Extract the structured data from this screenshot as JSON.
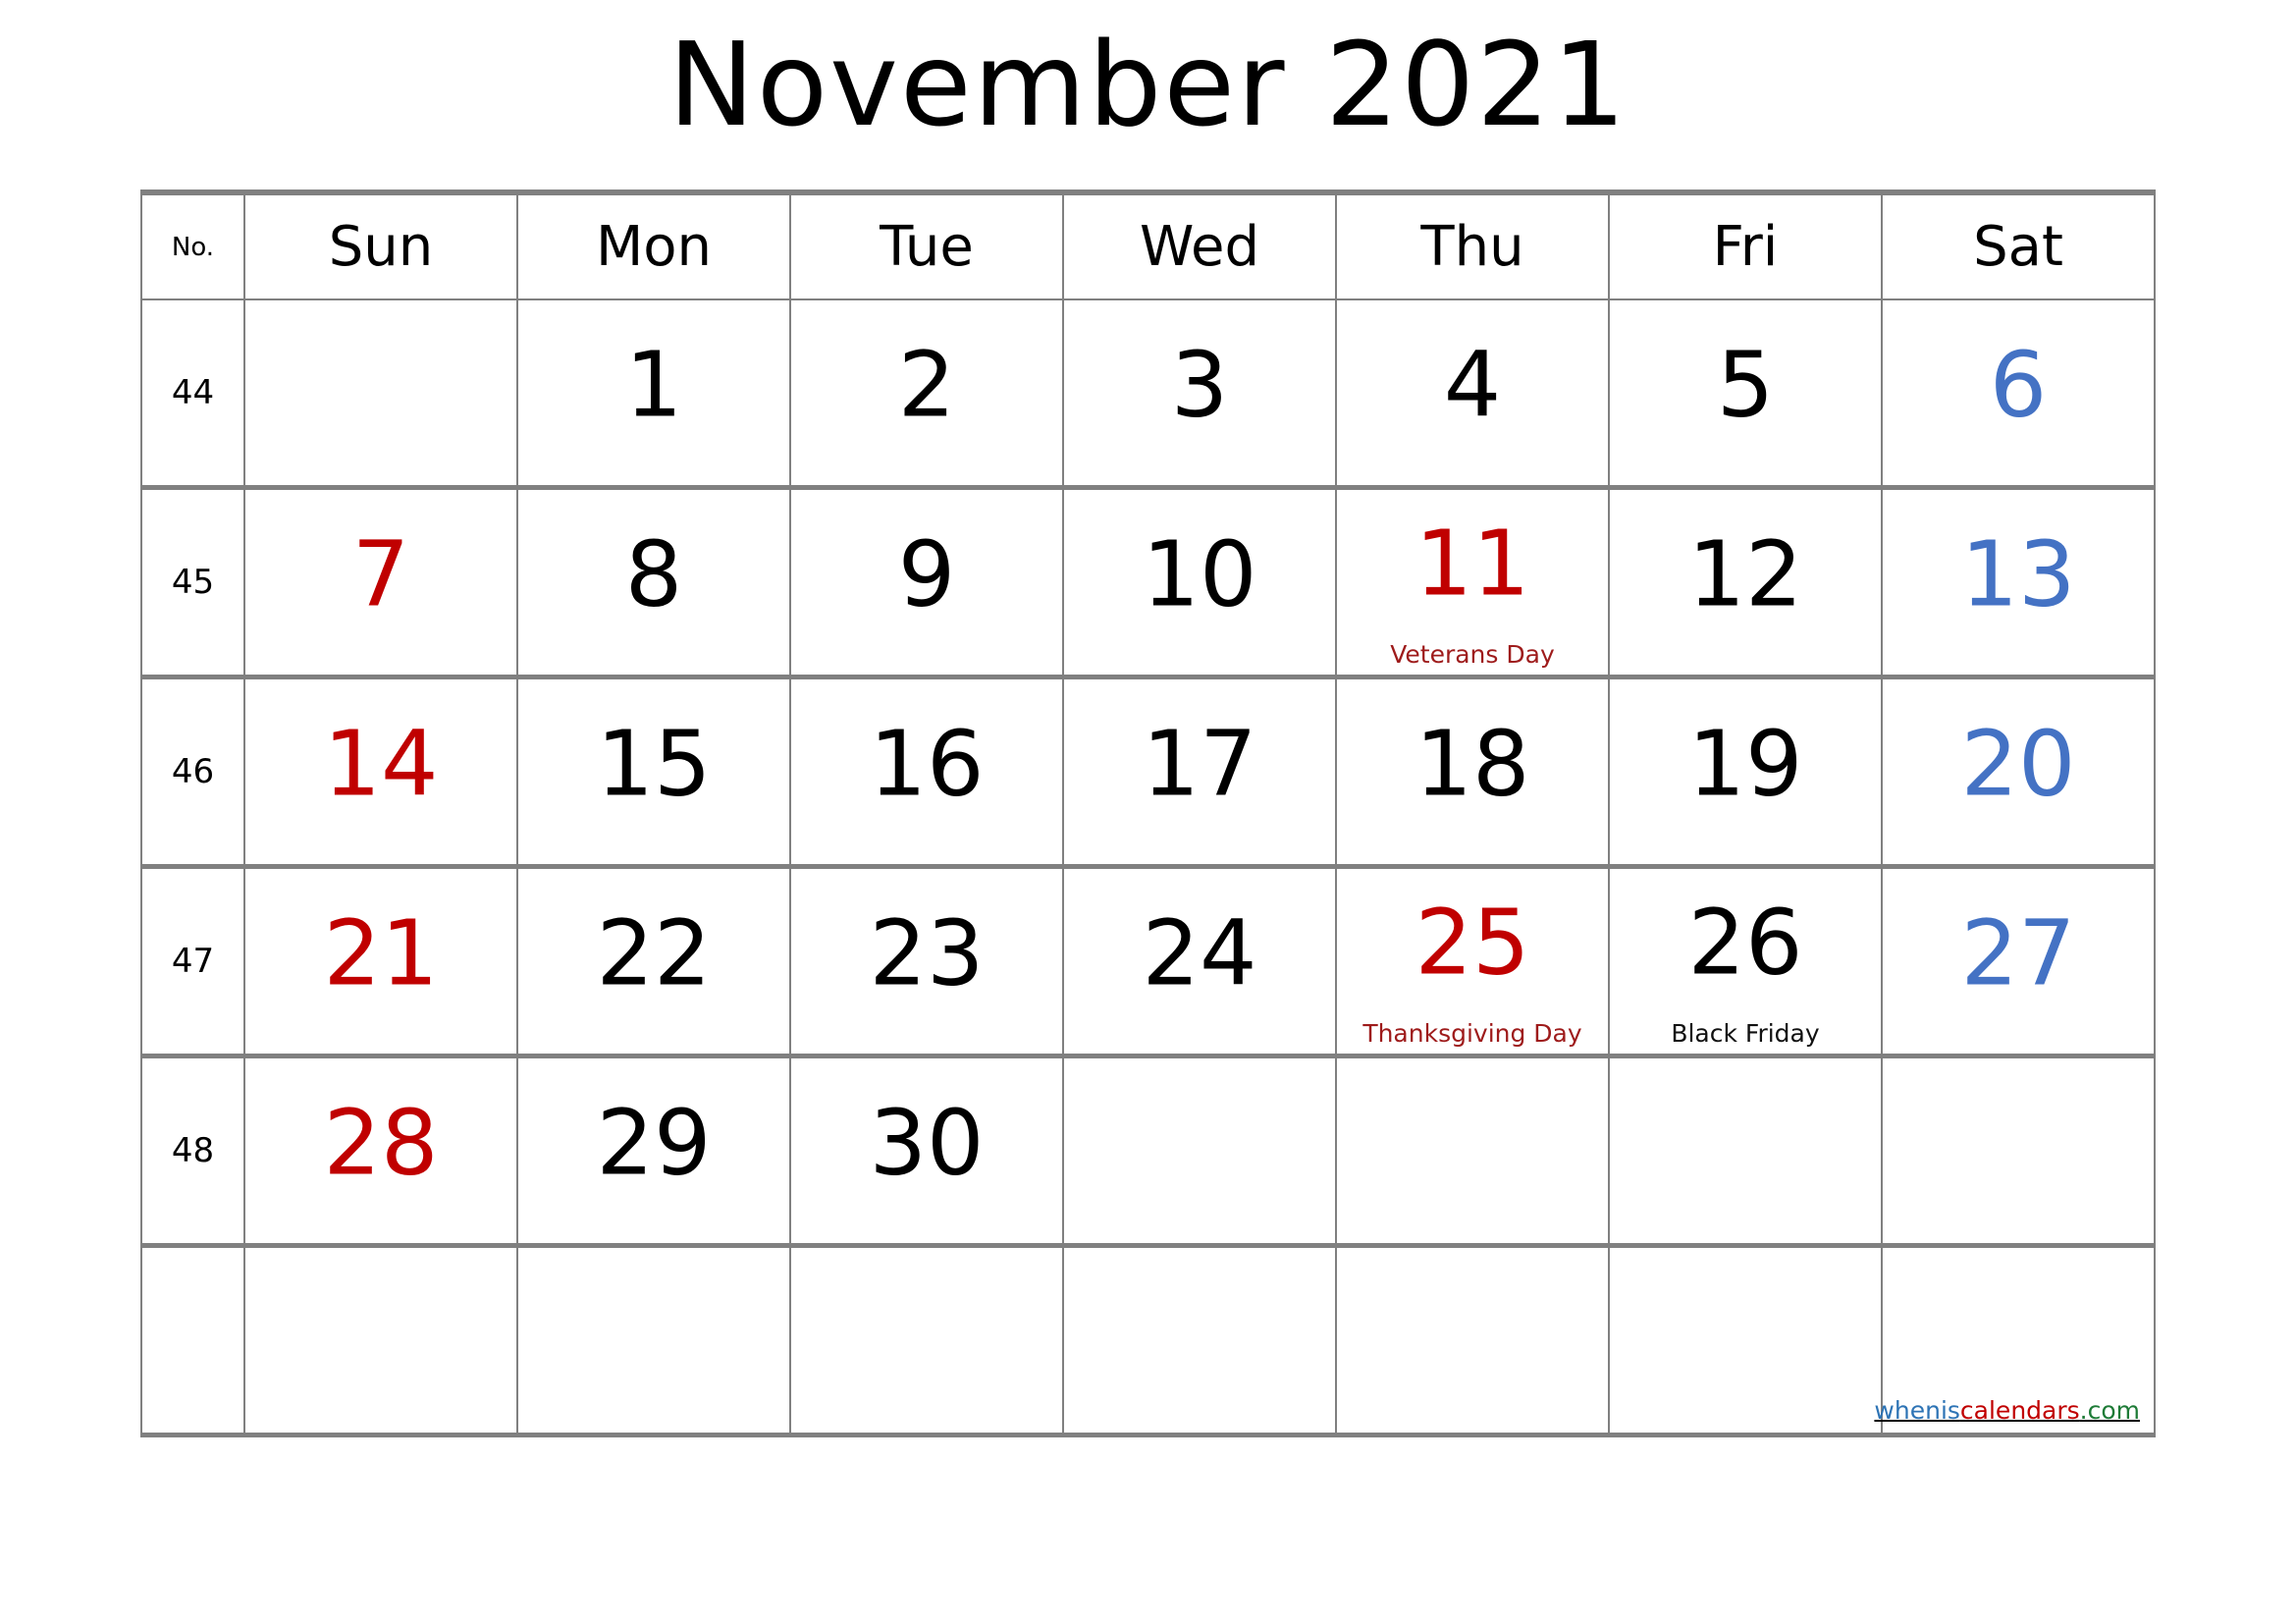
{
  "title": "November 2021",
  "month": "November",
  "year": "2021",
  "header": {
    "week_number_label": "No.",
    "days": [
      "Sun",
      "Mon",
      "Tue",
      "Wed",
      "Thu",
      "Fri",
      "Sat"
    ]
  },
  "colors": {
    "sunday": "#C00000",
    "saturday": "#4472C4",
    "holiday": "#C00000",
    "weekday": "#000000",
    "grid": "#808080",
    "note_red": "#9E1B1B",
    "note_black": "#111111",
    "watermark_blue": "#2E74B5",
    "watermark_red": "#C00000",
    "watermark_green": "#1E7B37"
  },
  "weeks": [
    {
      "number": "44",
      "days": [
        {
          "date": "",
          "style": "sun",
          "note": "",
          "note_style": ""
        },
        {
          "date": "1",
          "style": "wk",
          "note": "",
          "note_style": ""
        },
        {
          "date": "2",
          "style": "wk",
          "note": "",
          "note_style": ""
        },
        {
          "date": "3",
          "style": "wk",
          "note": "",
          "note_style": ""
        },
        {
          "date": "4",
          "style": "wk",
          "note": "",
          "note_style": ""
        },
        {
          "date": "5",
          "style": "wk",
          "note": "",
          "note_style": ""
        },
        {
          "date": "6",
          "style": "sat",
          "note": "",
          "note_style": ""
        }
      ]
    },
    {
      "number": "45",
      "days": [
        {
          "date": "7",
          "style": "sun",
          "note": "",
          "note_style": ""
        },
        {
          "date": "8",
          "style": "wk",
          "note": "",
          "note_style": ""
        },
        {
          "date": "9",
          "style": "wk",
          "note": "",
          "note_style": ""
        },
        {
          "date": "10",
          "style": "wk",
          "note": "",
          "note_style": ""
        },
        {
          "date": "11",
          "style": "hol",
          "note": "Veterans Day",
          "note_style": "red"
        },
        {
          "date": "12",
          "style": "wk",
          "note": "",
          "note_style": ""
        },
        {
          "date": "13",
          "style": "sat",
          "note": "",
          "note_style": ""
        }
      ]
    },
    {
      "number": "46",
      "days": [
        {
          "date": "14",
          "style": "sun",
          "note": "",
          "note_style": ""
        },
        {
          "date": "15",
          "style": "wk",
          "note": "",
          "note_style": ""
        },
        {
          "date": "16",
          "style": "wk",
          "note": "",
          "note_style": ""
        },
        {
          "date": "17",
          "style": "wk",
          "note": "",
          "note_style": ""
        },
        {
          "date": "18",
          "style": "wk",
          "note": "",
          "note_style": ""
        },
        {
          "date": "19",
          "style": "wk",
          "note": "",
          "note_style": ""
        },
        {
          "date": "20",
          "style": "sat",
          "note": "",
          "note_style": ""
        }
      ]
    },
    {
      "number": "47",
      "days": [
        {
          "date": "21",
          "style": "sun",
          "note": "",
          "note_style": ""
        },
        {
          "date": "22",
          "style": "wk",
          "note": "",
          "note_style": ""
        },
        {
          "date": "23",
          "style": "wk",
          "note": "",
          "note_style": ""
        },
        {
          "date": "24",
          "style": "wk",
          "note": "",
          "note_style": ""
        },
        {
          "date": "25",
          "style": "hol",
          "note": "Thanksgiving Day",
          "note_style": "red"
        },
        {
          "date": "26",
          "style": "wk",
          "note": "Black Friday",
          "note_style": "black"
        },
        {
          "date": "27",
          "style": "sat",
          "note": "",
          "note_style": ""
        }
      ]
    },
    {
      "number": "48",
      "days": [
        {
          "date": "28",
          "style": "sun",
          "note": "",
          "note_style": ""
        },
        {
          "date": "29",
          "style": "wk",
          "note": "",
          "note_style": ""
        },
        {
          "date": "30",
          "style": "wk",
          "note": "",
          "note_style": ""
        },
        {
          "date": "",
          "style": "wk",
          "note": "",
          "note_style": ""
        },
        {
          "date": "",
          "style": "wk",
          "note": "",
          "note_style": ""
        },
        {
          "date": "",
          "style": "wk",
          "note": "",
          "note_style": ""
        },
        {
          "date": "",
          "style": "sat",
          "note": "",
          "note_style": ""
        }
      ]
    },
    {
      "number": "",
      "days": [
        {
          "date": "",
          "style": "sun",
          "note": "",
          "note_style": ""
        },
        {
          "date": "",
          "style": "wk",
          "note": "",
          "note_style": ""
        },
        {
          "date": "",
          "style": "wk",
          "note": "",
          "note_style": ""
        },
        {
          "date": "",
          "style": "wk",
          "note": "",
          "note_style": ""
        },
        {
          "date": "",
          "style": "wk",
          "note": "",
          "note_style": ""
        },
        {
          "date": "",
          "style": "wk",
          "note": "",
          "note_style": ""
        },
        {
          "date": "",
          "style": "sat",
          "note": "",
          "note_style": ""
        }
      ]
    }
  ],
  "watermark": {
    "part1": "whenis",
    "part2": "calendars",
    "part3": ".com"
  }
}
